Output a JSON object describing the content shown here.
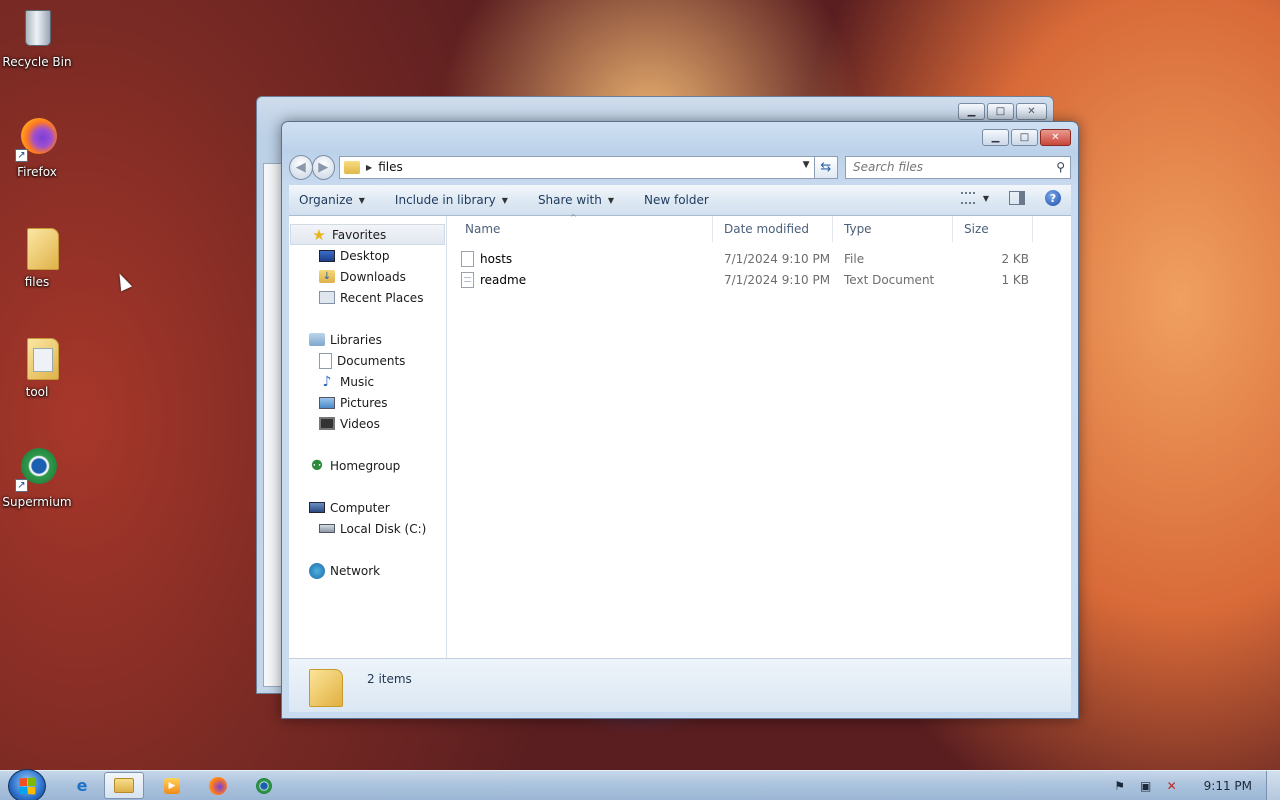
{
  "desktop": {
    "icons": [
      {
        "label": "Recycle Bin"
      },
      {
        "label": "Firefox"
      },
      {
        "label": "files"
      },
      {
        "label": "tool"
      },
      {
        "label": "Supermium"
      }
    ]
  },
  "explorer": {
    "address": {
      "path": "files"
    },
    "search": {
      "placeholder": "Search files"
    },
    "toolbar": {
      "organize": "Organize",
      "include_in_library": "Include in library",
      "share_with": "Share with",
      "new_folder": "New folder"
    },
    "nav": {
      "favorites": {
        "label": "Favorites",
        "items": [
          "Desktop",
          "Downloads",
          "Recent Places"
        ]
      },
      "libraries": {
        "label": "Libraries",
        "items": [
          "Documents",
          "Music",
          "Pictures",
          "Videos"
        ]
      },
      "homegroup": {
        "label": "Homegroup"
      },
      "computer": {
        "label": "Computer",
        "items": [
          "Local Disk (C:)"
        ]
      },
      "network": {
        "label": "Network"
      }
    },
    "columns": {
      "name": "Name",
      "date": "Date modified",
      "type": "Type",
      "size": "Size"
    },
    "files": [
      {
        "name": "hosts",
        "date": "7/1/2024 9:10 PM",
        "type": "File",
        "size": "2 KB"
      },
      {
        "name": "readme",
        "date": "7/1/2024 9:10 PM",
        "type": "Text Document",
        "size": "1 KB"
      }
    ],
    "status": {
      "item_count": "2 items"
    }
  },
  "taskbar": {
    "clock": "9:11 PM",
    "colors": {
      "start_orb": "#2a6fc8",
      "taskbar": "#aac2dc"
    }
  }
}
